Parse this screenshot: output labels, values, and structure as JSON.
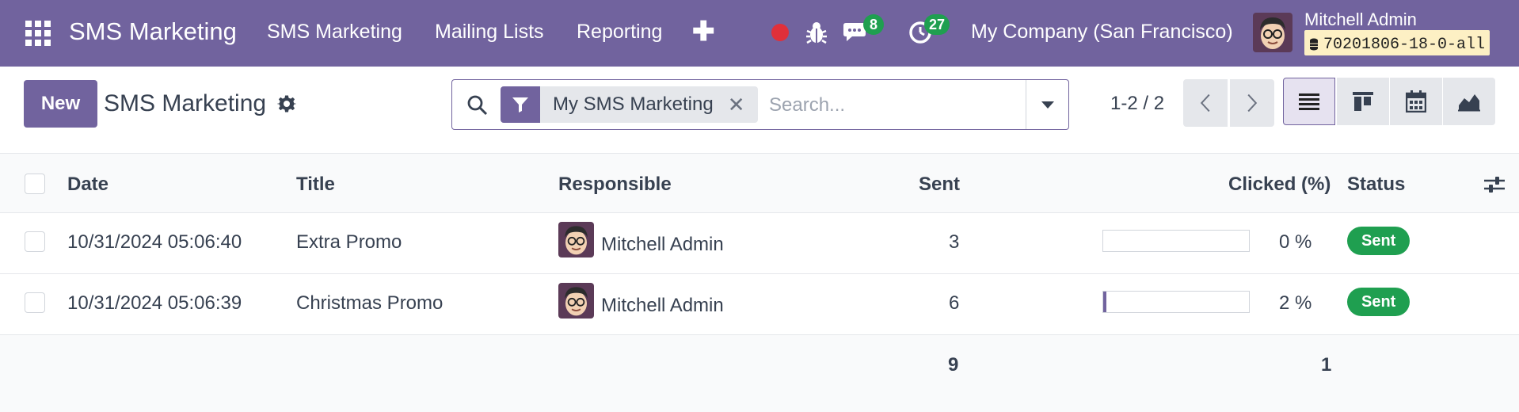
{
  "navbar": {
    "brand": "SMS Marketing",
    "menu": [
      "SMS Marketing",
      "Mailing Lists",
      "Reporting"
    ],
    "messages_count": "8",
    "activities_count": "27",
    "company": "My Company (San Francisco)",
    "user_name": "Mitchell Admin",
    "database": "70201806-18-0-all"
  },
  "control": {
    "new_label": "New",
    "title": "SMS Marketing",
    "filter_facet": "My SMS Marketing",
    "search_placeholder": "Search...",
    "pager": "1-2 / 2"
  },
  "table": {
    "columns": [
      "Date",
      "Title",
      "Responsible",
      "Sent",
      "Clicked (%)",
      "Status"
    ],
    "rows": [
      {
        "date": "10/31/2024 05:06:40",
        "title": "Extra Promo",
        "responsible": "Mitchell Admin",
        "sent": "3",
        "clicked": "0 %",
        "clicked_fraction": 0,
        "status": "Sent"
      },
      {
        "date": "10/31/2024 05:06:39",
        "title": "Christmas Promo",
        "responsible": "Mitchell Admin",
        "sent": "6",
        "clicked": "2 %",
        "clicked_fraction": 0.02,
        "status": "Sent"
      }
    ],
    "totals": {
      "sent": "9",
      "clicked": "1"
    }
  },
  "icons": [
    "apps-grid-icon",
    "plus-icon",
    "record-icon",
    "bug-icon",
    "chat-icon",
    "clock-icon",
    "database-icon",
    "gear-icon",
    "search-icon",
    "filter-icon",
    "close-icon",
    "caret-down-icon",
    "chevron-left-icon",
    "chevron-right-icon",
    "list-view-icon",
    "kanban-view-icon",
    "calendar-view-icon",
    "graph-view-icon",
    "optional-columns-icon"
  ],
  "colors": {
    "brand": "#71639e",
    "success": "#1f9f50",
    "record": "#e0303a",
    "db_tag_bg": "#fdf0c4"
  }
}
